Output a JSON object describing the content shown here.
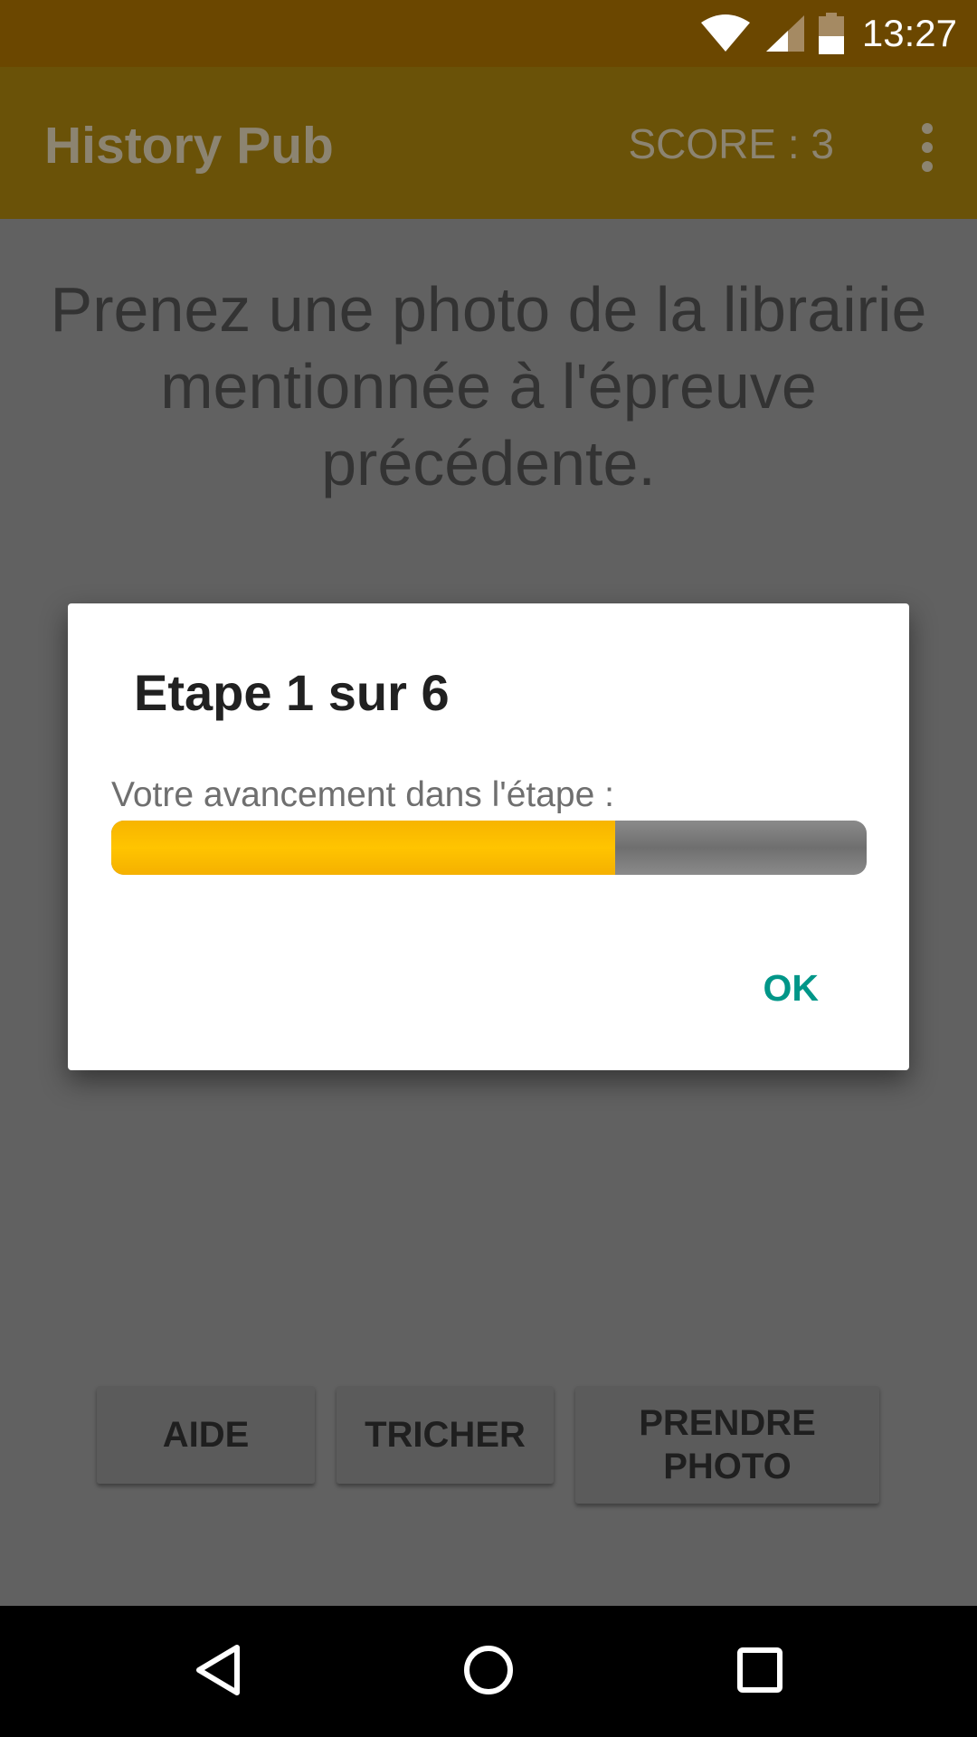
{
  "status_bar": {
    "time": "13:27",
    "icons": [
      "wifi-icon",
      "signal-icon",
      "battery-icon"
    ]
  },
  "app_bar": {
    "title": "History Pub",
    "score": "SCORE : 3",
    "menu_icon": "overflow-menu-icon"
  },
  "content": {
    "instruction": "Prenez une photo de la librairie mentionnée à l'épreuve précédente.",
    "buttons": {
      "aide": "AIDE",
      "tricher": "TRICHER",
      "prendre_photo": "PRENDRE PHOTO"
    }
  },
  "dialog": {
    "title": "Etape 1 sur 6",
    "progress_label": "Votre avancement dans l'étape :",
    "progress_value": 0.667,
    "ok_label": "OK"
  },
  "nav_bar": {
    "icons": [
      "back-icon",
      "home-icon",
      "recents-icon"
    ]
  },
  "colors": {
    "status_bar": "#6b4700",
    "app_bar": "#6a5208",
    "progress_fill": "#ffc107",
    "accent": "#009688"
  }
}
